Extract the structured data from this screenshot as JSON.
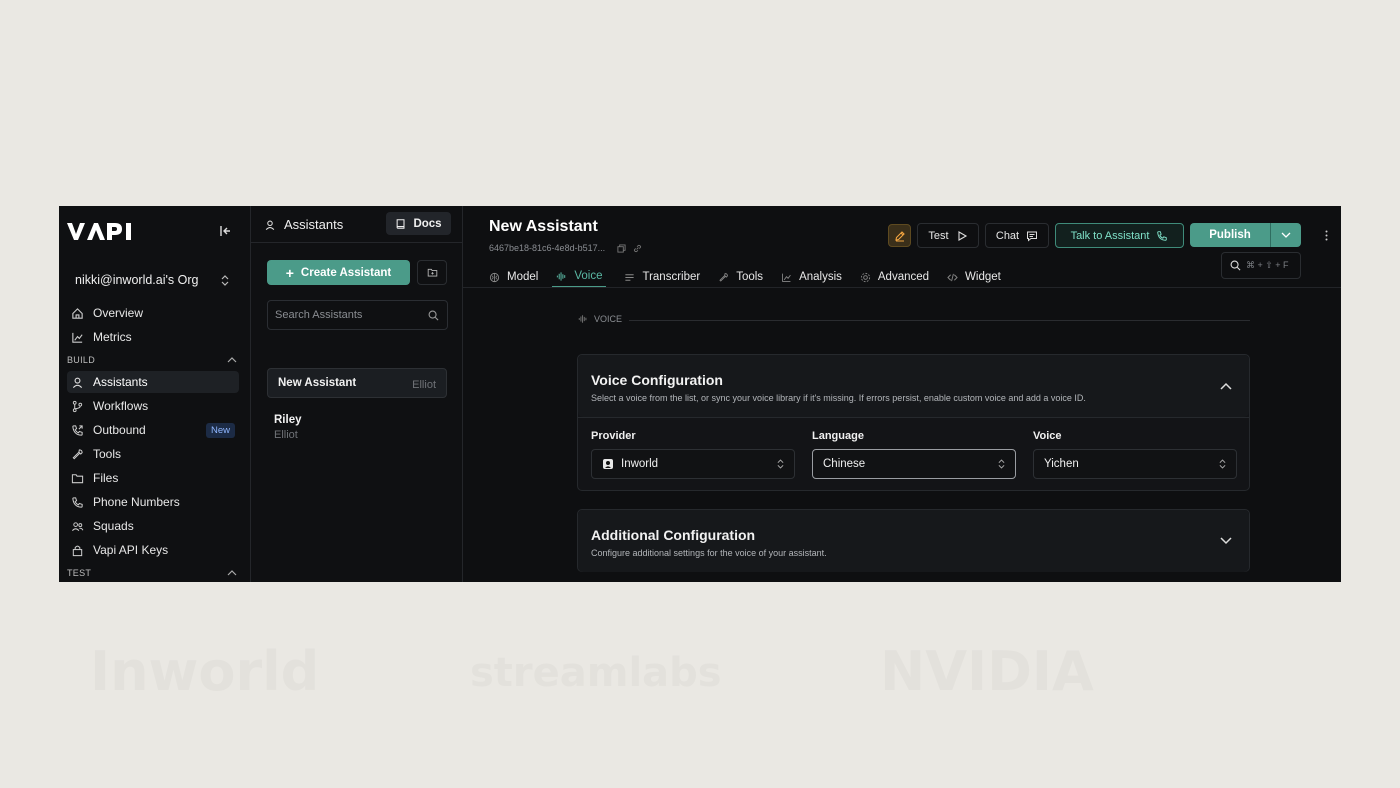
{
  "sidebar": {
    "logo": "VAPI",
    "org": "nikki@inworld.ai's Org",
    "items_top": [
      {
        "label": "Overview",
        "icon": "home-icon"
      },
      {
        "label": "Metrics",
        "icon": "chart-icon"
      }
    ],
    "section_build": "BUILD",
    "items_build": [
      {
        "label": "Assistants",
        "icon": "user-icon",
        "active": true
      },
      {
        "label": "Workflows",
        "icon": "branch-icon"
      },
      {
        "label": "Outbound",
        "icon": "phone-out-icon",
        "badge": "New"
      },
      {
        "label": "Tools",
        "icon": "wrench-icon"
      },
      {
        "label": "Files",
        "icon": "folder-icon"
      },
      {
        "label": "Phone Numbers",
        "icon": "phone-icon"
      },
      {
        "label": "Squads",
        "icon": "users-icon"
      },
      {
        "label": "Vapi API Keys",
        "icon": "lock-icon"
      }
    ],
    "section_test": "TEST"
  },
  "assistants_panel": {
    "title": "Assistants",
    "docs_label": "Docs",
    "create_label": "Create Assistant",
    "search_placeholder": "Search Assistants",
    "items": [
      {
        "name": "New Assistant",
        "voice": "Elliot",
        "selected": true
      },
      {
        "name": "Riley",
        "voice": "Elliot"
      }
    ]
  },
  "header": {
    "title": "New Assistant",
    "id": "6467be18-81c6-4e8d-b517...",
    "test_label": "Test",
    "chat_label": "Chat",
    "talk_label": "Talk to Assistant",
    "publish_label": "Publish",
    "shortcut": "⌘ + ⇧ + F"
  },
  "tabs": [
    {
      "label": "Model",
      "icon": "brain-icon"
    },
    {
      "label": "Voice",
      "icon": "waveform-icon",
      "active": true
    },
    {
      "label": "Transcriber",
      "icon": "lines-icon"
    },
    {
      "label": "Tools",
      "icon": "wrench-icon"
    },
    {
      "label": "Analysis",
      "icon": "chart-icon"
    },
    {
      "label": "Advanced",
      "icon": "gear-icon"
    },
    {
      "label": "Widget",
      "icon": "code-icon"
    }
  ],
  "voice_section": {
    "label": "VOICE",
    "config": {
      "title": "Voice Configuration",
      "subtitle": "Select a voice from the list, or sync your voice library if it's missing. If errors persist, enable custom voice and add a voice ID.",
      "provider_label": "Provider",
      "provider_value": "Inworld",
      "language_label": "Language",
      "language_value": "Chinese",
      "voice_label": "Voice",
      "voice_value": "Yichen"
    },
    "additional": {
      "title": "Additional Configuration",
      "subtitle": "Configure additional settings for the voice of your assistant."
    }
  },
  "watermarks": [
    "Inworld",
    "streamlabs",
    "NVIDIA"
  ],
  "colors": {
    "accent": "#4b9b89",
    "background": "#0e0f11",
    "page": "#eae8e3"
  }
}
